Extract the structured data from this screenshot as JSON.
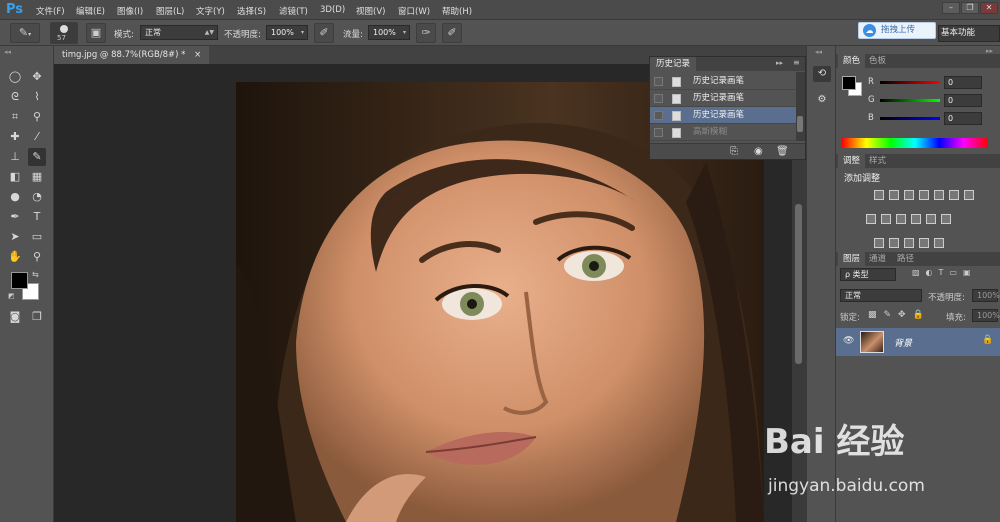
{
  "app": {
    "logo": "Ps"
  },
  "menu": [
    "文件(F)",
    "编辑(E)",
    "图像(I)",
    "图层(L)",
    "文字(Y)",
    "选择(S)",
    "滤镜(T)",
    "3D(D)",
    "视图(V)",
    "窗口(W)",
    "帮助(H)"
  ],
  "window_controls": [
    "–",
    "❐",
    "✕"
  ],
  "options": {
    "brush_size": "57",
    "mode_label": "模式:",
    "mode_value": "正常",
    "opacity_label": "不透明度:",
    "opacity_value": "100%",
    "flow_label": "流量:",
    "flow_value": "100%"
  },
  "upload_button": "拖拽上传",
  "workspace": "基本功能",
  "document_tab": {
    "title": "timg.jpg @ 88.7%(RGB/8#) *",
    "close": "×"
  },
  "history": {
    "tab": "历史记录",
    "rows": [
      {
        "label": "历史记录画笔",
        "selected": false,
        "dim": false
      },
      {
        "label": "历史记录画笔",
        "selected": false,
        "dim": false
      },
      {
        "label": "历史记录画笔",
        "selected": true,
        "dim": false
      },
      {
        "label": "高斯模糊",
        "selected": false,
        "dim": true
      }
    ]
  },
  "color_panel": {
    "tabs": [
      "颜色",
      "色板"
    ],
    "channels": [
      {
        "label": "R",
        "value": "0",
        "color": "#ff0000"
      },
      {
        "label": "G",
        "value": "0",
        "color": "#00ff00"
      },
      {
        "label": "B",
        "value": "0",
        "color": "#0000ff"
      }
    ]
  },
  "adjust_panel": {
    "tabs": [
      "调整",
      "样式"
    ],
    "title": "添加调整"
  },
  "layers_panel": {
    "tabs": [
      "图层",
      "通道",
      "路径"
    ],
    "filter": "ρ 类型",
    "blend_mode": "正常",
    "opacity_label": "不透明度:",
    "opacity_value": "100%",
    "lock_label": "锁定:",
    "fill_label": "填充:",
    "fill_value": "100%",
    "layer_name": "背景"
  },
  "watermark": {
    "text": "Bai 经验",
    "url": "jingyan.baidu.com"
  },
  "colors": {
    "accent": "#3aa0e8",
    "selection": "#5a6f8f",
    "foreground": "#000000",
    "background": "#ffffff"
  }
}
